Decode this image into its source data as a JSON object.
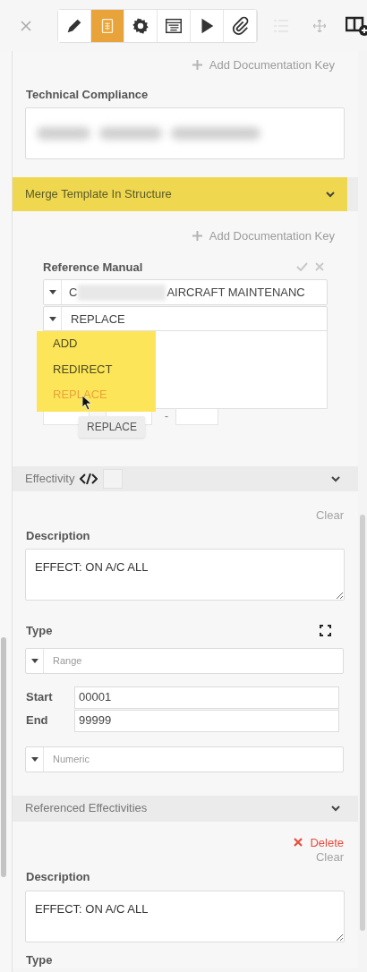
{
  "toolbar": {
    "tools": [
      {
        "selected": false
      },
      {
        "selected": true
      },
      {
        "selected": false
      },
      {
        "selected": false
      },
      {
        "selected": false
      },
      {
        "selected": false
      }
    ]
  },
  "documentation": {
    "add_key_link": "Add Documentation Key",
    "technical_compliance": {
      "label": "Technical Compliance"
    }
  },
  "merge_section": {
    "title": "Merge Template In Structure",
    "highlighted": true,
    "add_key_link": "Add Documentation Key",
    "reference_manual": {
      "label": "Reference Manual",
      "manual_value_start": "C",
      "manual_value_end": "AIRCRAFT MAINTENANC",
      "action_select": {
        "value": "REPLACE",
        "expanded": true,
        "highlighted": true,
        "options": [
          {
            "label": "ADD",
            "selected": false
          },
          {
            "label": "REDIRECT",
            "selected": false
          },
          {
            "label": "REPLACE",
            "selected": true
          }
        ]
      },
      "range_separator": "-",
      "tooltip": "REPLACE"
    }
  },
  "effectivity": {
    "title": "Effectivity",
    "clear_link": "Clear",
    "description": {
      "label": "Description",
      "value": "EFFECT: ON A/C ALL"
    },
    "type": {
      "label": "Type",
      "range_select": "Range",
      "start_label": "Start",
      "start_value": "00001",
      "end_label": "End",
      "end_value": "99999",
      "format_select": "Numeric"
    }
  },
  "referenced_effectivities": {
    "title": "Referenced Effectivities",
    "delete_link": "Delete",
    "clear_link": "Clear",
    "description": {
      "label": "Description",
      "value": "EFFECT: ON A/C ALL"
    },
    "type_label": "Type"
  }
}
